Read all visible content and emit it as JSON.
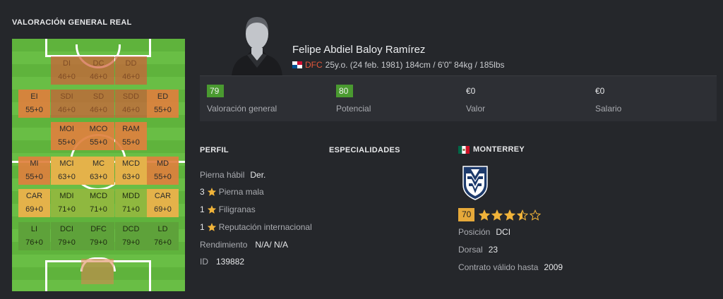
{
  "title": "VALORACIÓN GENERAL REAL",
  "pitch_rows": [
    [
      {
        "pos": "",
        "val": ""
      },
      {
        "pos": "DI",
        "val": "46+0"
      },
      {
        "pos": "DC",
        "val": "46+0"
      },
      {
        "pos": "DD",
        "val": "46+0"
      },
      {
        "pos": "",
        "val": ""
      }
    ],
    [
      {
        "pos": "EI",
        "val": "55+0"
      },
      {
        "pos": "SDI",
        "val": "46+0"
      },
      {
        "pos": "SD",
        "val": "46+0"
      },
      {
        "pos": "SDD",
        "val": "46+0"
      },
      {
        "pos": "ED",
        "val": "55+0"
      }
    ],
    [
      {
        "pos": "",
        "val": ""
      },
      {
        "pos": "MOI",
        "val": "55+0"
      },
      {
        "pos": "MCO",
        "val": "55+0"
      },
      {
        "pos": "RAM",
        "val": "55+0"
      },
      {
        "pos": "",
        "val": ""
      }
    ],
    [
      {
        "pos": "MI",
        "val": "55+0"
      },
      {
        "pos": "MCI",
        "val": "63+0"
      },
      {
        "pos": "MC",
        "val": "63+0"
      },
      {
        "pos": "MCD",
        "val": "63+0"
      },
      {
        "pos": "MD",
        "val": "55+0"
      }
    ],
    [
      {
        "pos": "CAR",
        "val": "69+0"
      },
      {
        "pos": "MDI",
        "val": "71+0"
      },
      {
        "pos": "MCD",
        "val": "71+0"
      },
      {
        "pos": "MDD",
        "val": "71+0"
      },
      {
        "pos": "CAR",
        "val": "69+0"
      }
    ],
    [
      {
        "pos": "LI",
        "val": "76+0"
      },
      {
        "pos": "DCI",
        "val": "79+0"
      },
      {
        "pos": "DFC",
        "val": "79+0"
      },
      {
        "pos": "DCD",
        "val": "79+0"
      },
      {
        "pos": "LD",
        "val": "76+0"
      }
    ]
  ],
  "player": {
    "name": "Felipe Abdiel Baloy Ramírez",
    "position": "DFC",
    "details": "25y.o. (24 feb. 1981) 184cm / 6'0\" 84kg / 185lbs"
  },
  "stats": {
    "overall": "79",
    "overall_label": "Valoración general",
    "potential": "80",
    "potential_label": "Potencial",
    "value": "€0",
    "value_label": "Valor",
    "salary": "€0",
    "salary_label": "Salario"
  },
  "profile": {
    "heading": "PERFIL",
    "foot_label": "Pierna hábil",
    "foot_value": "Der.",
    "weak_foot_value": "3",
    "weak_foot_label": "Pierna mala",
    "skills_value": "1",
    "skills_label": "Filigranas",
    "reputation_value": "1",
    "reputation_label": "Reputación internacional",
    "workrate_label": "Rendimiento",
    "workrate_value": "N/A/ N/A",
    "id_label": "ID",
    "id_value": "139882"
  },
  "specialities": {
    "heading": "ESPECIALIDADES"
  },
  "club": {
    "name": "MONTERREY",
    "rating": "70",
    "stars": 3.5,
    "position_label": "Posición",
    "position_value": "DCI",
    "number_label": "Dorsal",
    "number_value": "23",
    "contract_label": "Contrato válido hasta",
    "contract_value": "2009"
  },
  "colors": {
    "accent_red": "#e5573a",
    "rating_green": "#4a9a30",
    "club_badge": "#e6a93a",
    "star": "#f0b33a"
  }
}
